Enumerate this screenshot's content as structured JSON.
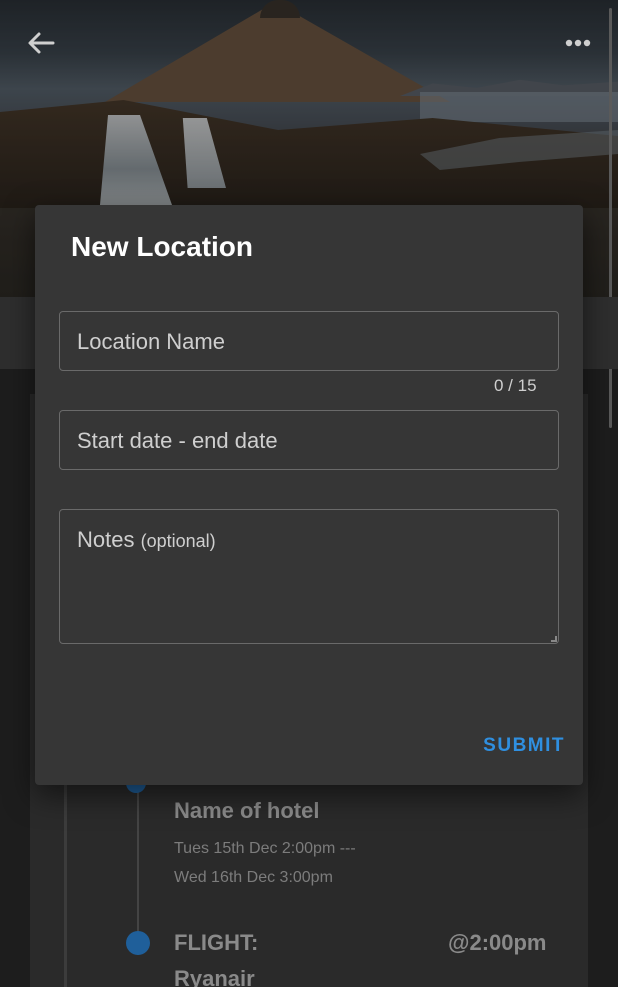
{
  "header": {
    "back_icon": "arrow-left-icon",
    "more_icon": "more-horizontal-icon"
  },
  "dialog": {
    "title": "New Location",
    "location_name": {
      "label": "Location Name",
      "value": "",
      "counter": "0 / 15"
    },
    "dates": {
      "label": "Start date - end date",
      "value": ""
    },
    "notes": {
      "label": "Notes",
      "optional": "(optional)",
      "value": ""
    },
    "submit_label": "SUBMIT",
    "accent_color": "#2f8fe0"
  },
  "timeline": {
    "items": [
      {
        "title": "Name of hotel",
        "dates_line1": "Tues 15th Dec 2:00pm ---",
        "dates_line2": "Wed 16th Dec 3:00pm"
      },
      {
        "type_label": "FLIGHT:",
        "time": "@2:00pm",
        "airline": "Ryanair"
      }
    ],
    "dot_color": "#1f5f9a"
  }
}
